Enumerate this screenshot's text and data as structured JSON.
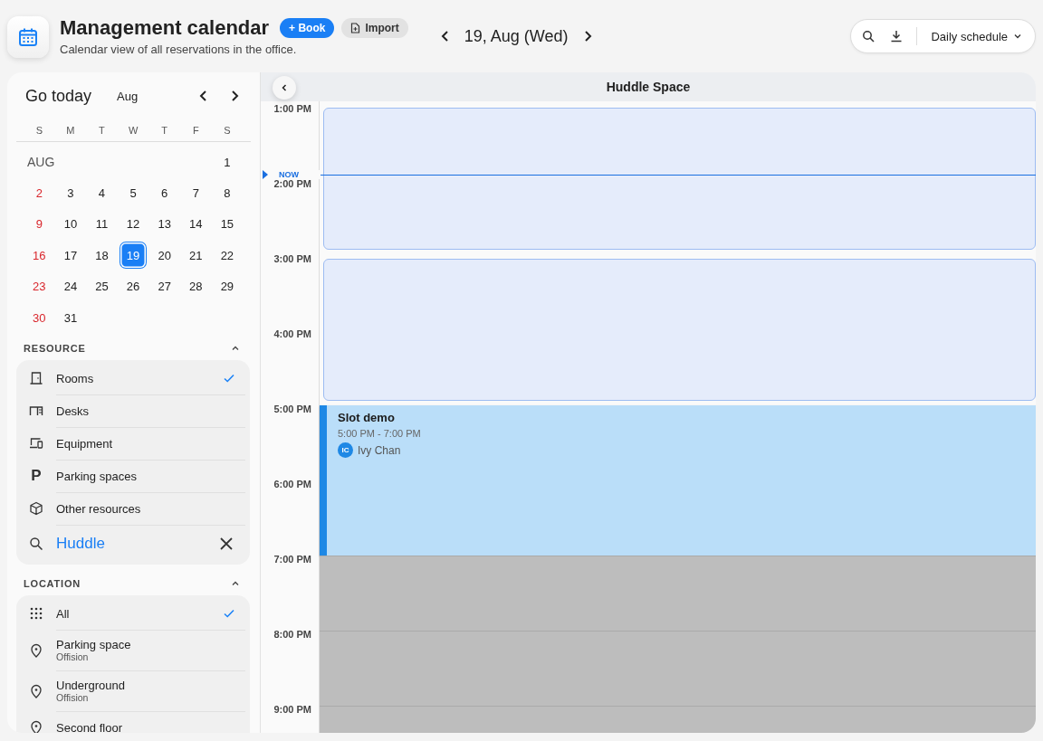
{
  "header": {
    "title": "Management calendar",
    "subtitle": "Calendar view of all reservations in the office.",
    "book_button": "+ Book",
    "import_button": "Import"
  },
  "date_nav": {
    "date": "19, Aug (Wed)"
  },
  "toolbar": {
    "view": "Daily schedule"
  },
  "mini_calendar": {
    "go_today": "Go today",
    "month": "Aug",
    "weekdays": [
      "S",
      "M",
      "T",
      "W",
      "T",
      "F",
      "S"
    ],
    "month_label": "AUG",
    "days": [
      {
        "d": "1",
        "sunday": false,
        "selected": false
      },
      {
        "d": "2",
        "sunday": true,
        "selected": false
      },
      {
        "d": "3",
        "sunday": false,
        "selected": false
      },
      {
        "d": "4",
        "sunday": false,
        "selected": false
      },
      {
        "d": "5",
        "sunday": false,
        "selected": false
      },
      {
        "d": "6",
        "sunday": false,
        "selected": false
      },
      {
        "d": "7",
        "sunday": false,
        "selected": false
      },
      {
        "d": "8",
        "sunday": false,
        "selected": false
      },
      {
        "d": "9",
        "sunday": true,
        "selected": false
      },
      {
        "d": "10",
        "sunday": false,
        "selected": false
      },
      {
        "d": "11",
        "sunday": false,
        "selected": false
      },
      {
        "d": "12",
        "sunday": false,
        "selected": false
      },
      {
        "d": "13",
        "sunday": false,
        "selected": false
      },
      {
        "d": "14",
        "sunday": false,
        "selected": false
      },
      {
        "d": "15",
        "sunday": false,
        "selected": false
      },
      {
        "d": "16",
        "sunday": true,
        "selected": false
      },
      {
        "d": "17",
        "sunday": false,
        "selected": false
      },
      {
        "d": "18",
        "sunday": false,
        "selected": false
      },
      {
        "d": "19",
        "sunday": false,
        "selected": true
      },
      {
        "d": "20",
        "sunday": false,
        "selected": false
      },
      {
        "d": "21",
        "sunday": false,
        "selected": false
      },
      {
        "d": "22",
        "sunday": false,
        "selected": false
      },
      {
        "d": "23",
        "sunday": true,
        "selected": false
      },
      {
        "d": "24",
        "sunday": false,
        "selected": false
      },
      {
        "d": "25",
        "sunday": false,
        "selected": false
      },
      {
        "d": "26",
        "sunday": false,
        "selected": false
      },
      {
        "d": "27",
        "sunday": false,
        "selected": false
      },
      {
        "d": "28",
        "sunday": false,
        "selected": false
      },
      {
        "d": "29",
        "sunday": false,
        "selected": false
      },
      {
        "d": "30",
        "sunday": true,
        "selected": false
      },
      {
        "d": "31",
        "sunday": false,
        "selected": false
      }
    ]
  },
  "resource": {
    "heading": "RESOURCE",
    "expanded": true,
    "items": [
      {
        "kind": "room",
        "label": "Rooms",
        "checked": true
      },
      {
        "kind": "desk",
        "label": "Desks",
        "checked": false
      },
      {
        "kind": "equipment",
        "label": "Equipment",
        "checked": false
      },
      {
        "kind": "parking",
        "glyph": "P",
        "label": "Parking spaces",
        "checked": false
      },
      {
        "kind": "other",
        "label": "Other resources",
        "checked": false
      }
    ],
    "search": {
      "value": "Huddle"
    }
  },
  "location": {
    "heading": "LOCATION",
    "expanded": true,
    "items": [
      {
        "kind": "all",
        "label": "All",
        "checked": true
      },
      {
        "kind": "place",
        "label": "Parking space",
        "sublabel": "Offision",
        "checked": false
      },
      {
        "kind": "place",
        "label": "Underground",
        "sublabel": "Offision",
        "checked": false
      },
      {
        "kind": "place",
        "label": "Second floor",
        "checked": false
      }
    ]
  },
  "schedule": {
    "resource": "Huddle Space",
    "now_label": "NOW",
    "hours": [
      "1:00 PM",
      "2:00 PM",
      "3:00 PM",
      "4:00 PM",
      "5:00 PM",
      "6:00 PM",
      "7:00 PM",
      "8:00 PM",
      "9:00 PM"
    ],
    "events": [
      {
        "kind": "available"
      },
      {
        "kind": "available"
      },
      {
        "kind": "booking",
        "title": "Slot demo",
        "time": "5:00 PM - 7:00 PM",
        "person": "Ivy Chan",
        "initials": "IC"
      },
      {
        "kind": "unavailable"
      }
    ]
  }
}
